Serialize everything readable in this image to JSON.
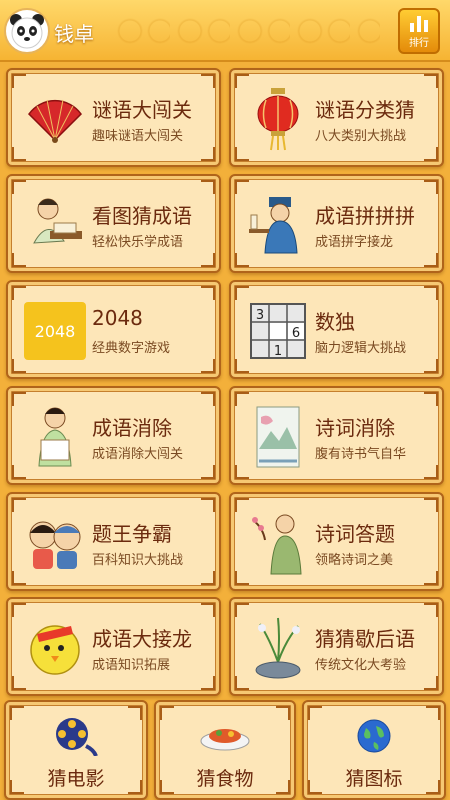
{
  "header": {
    "app_title": "钱卓",
    "rank_label": "排行"
  },
  "games": [
    {
      "title": "谜语大闯关",
      "subtitle": "趣味谜语大闯关",
      "icon": "folding-fan-icon"
    },
    {
      "title": "谜语分类猜",
      "subtitle": "八大类别大挑战",
      "icon": "red-lantern-icon"
    },
    {
      "title": "看图猜成语",
      "subtitle": "轻松快乐学成语",
      "icon": "scholar-reading-icon"
    },
    {
      "title": "成语拼拼拼",
      "subtitle": "成语拼字接龙",
      "icon": "scholar-writing-icon"
    },
    {
      "title": "2048",
      "subtitle": "经典数字游戏",
      "icon": "2048-tile-icon",
      "tile_text": "2048"
    },
    {
      "title": "数独",
      "subtitle": "脑力逻辑大挑战",
      "icon": "sudoku-grid-icon",
      "grid_digits": [
        "3",
        "6",
        "1"
      ]
    },
    {
      "title": "成语消除",
      "subtitle": "成语消除大闯关",
      "icon": "girl-with-scroll-icon"
    },
    {
      "title": "诗词消除",
      "subtitle": "腹有诗书气自华",
      "icon": "landscape-painting-icon"
    },
    {
      "title": "题王争霸",
      "subtitle": "百科知识大挑战",
      "icon": "kids-duo-icon"
    },
    {
      "title": "诗词答题",
      "subtitle": "领略诗词之美",
      "icon": "poet-with-plum-icon"
    },
    {
      "title": "成语大接龙",
      "subtitle": "成语知识拓展",
      "icon": "yellow-chick-icon"
    },
    {
      "title": "猜猜歇后语",
      "subtitle": "传统文化大考验",
      "icon": "orchid-pot-icon"
    }
  ],
  "bottom_games": [
    {
      "title": "猜电影",
      "icon": "film-reel-icon"
    },
    {
      "title": "猜食物",
      "icon": "food-plate-icon"
    },
    {
      "title": "猜图标",
      "icon": "globe-icon"
    }
  ],
  "colors": {
    "background": "#f3b03a",
    "card": "#fde6b8",
    "title_text": "#6b2a0e"
  }
}
